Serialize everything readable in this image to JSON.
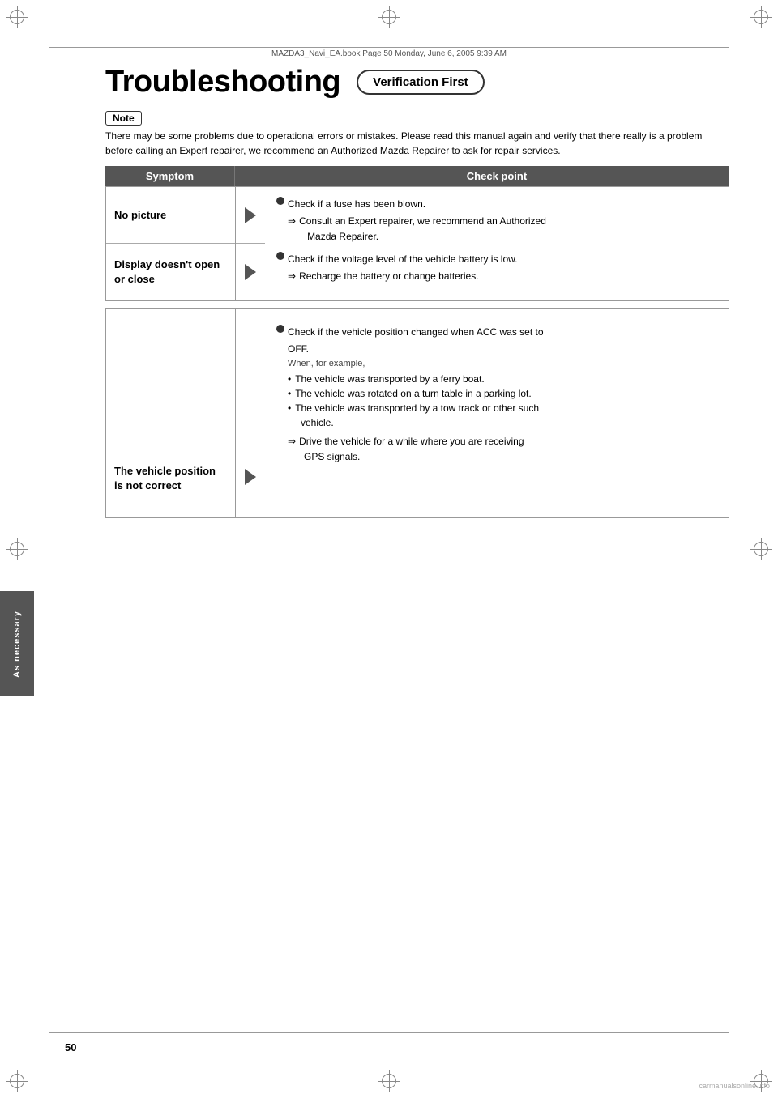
{
  "header": {
    "file_info": "MAZDA3_Navi_EA.book  Page 50  Monday, June 6, 2005  9:39 AM"
  },
  "page": {
    "number": "50",
    "title": "Troubleshooting",
    "verification_badge": "Verification First"
  },
  "note": {
    "label": "Note",
    "text": "There may be some problems due to operational errors or mistakes. Please read this manual again and verify that there really is a problem before calling an Expert repairer, we recommend an Authorized Mazda Repairer to ask for repair services."
  },
  "table": {
    "col_symptom": "Symptom",
    "col_checkpoint": "Check point",
    "rows": [
      {
        "symptom": "No picture",
        "checkpoints": [
          {
            "bullet": true,
            "text": "Check if a fuse has been blown.",
            "sub_arrow": "Consult an Expert repairer, we recommend an Authorized Mazda Repairer."
          },
          {
            "bullet": true,
            "text": "Check if the voltage level of the vehicle battery is low.",
            "sub_arrow": "Recharge the battery or change batteries."
          }
        ]
      },
      {
        "symptom": "Display doesn't open or close",
        "checkpoints": []
      },
      {
        "symptom": "The vehicle position is not correct",
        "checkpoints": [
          {
            "bullet": true,
            "text": "Check if the vehicle position changed when ACC was set to OFF.",
            "when": "When, for example,",
            "bullets": [
              "The vehicle was transported by a ferry boat.",
              "The vehicle was rotated on a turn table in a parking lot.",
              "The vehicle was transported by a tow track or other such vehicle."
            ],
            "sub_arrow_indent": "Drive the vehicle for a while where you are receiving GPS signals.",
            "sub_arrow_indent2": "GPS signals."
          }
        ]
      }
    ]
  },
  "side_tab": {
    "label": "As necessary"
  },
  "watermark": "carmanualsonline.info"
}
